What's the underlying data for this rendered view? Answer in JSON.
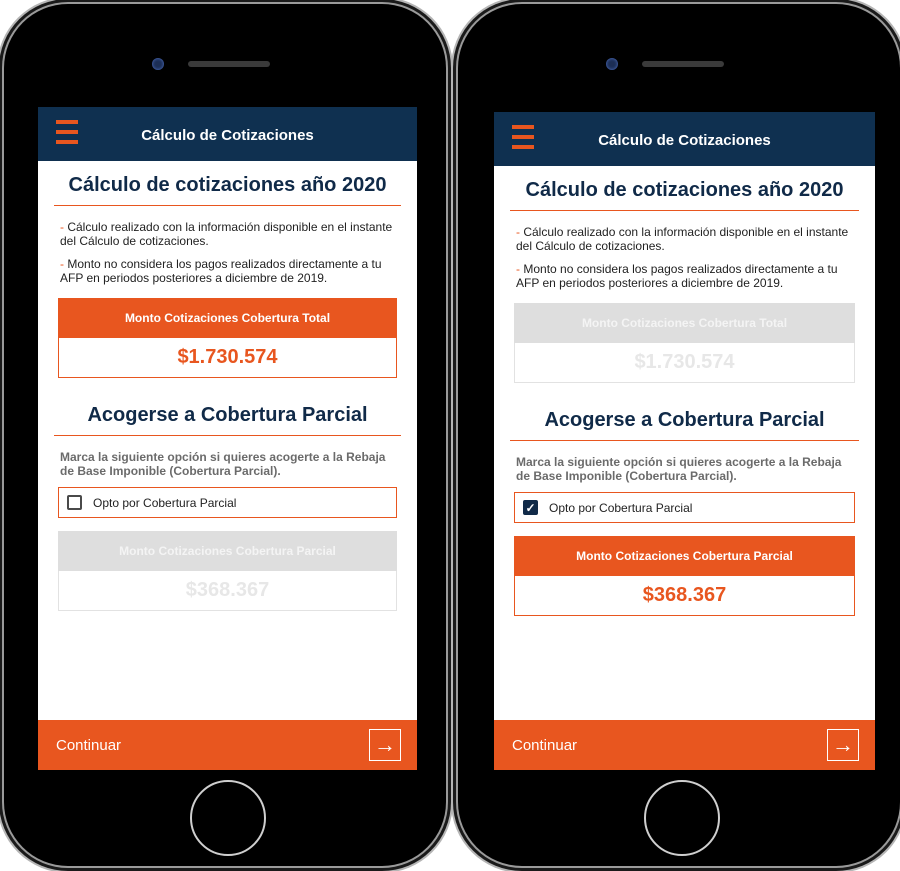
{
  "screens": [
    {
      "header_title": "Cálculo de Cotizaciones",
      "heading": "Cálculo de cotizaciones año 2020",
      "notes": [
        "Cálculo realizado con la información disponible en el instante del Cálculo de cotizaciones.",
        "Monto no considera los pagos realizados directamente a tu AFP en periodos posteriores a diciembre de 2019."
      ],
      "note_dash": "-",
      "total": {
        "label": "Monto Cotizaciones Cobertura Total",
        "value": "$1.730.574",
        "enabled": true
      },
      "partial_heading": "Acogerse a Cobertura Parcial",
      "partial_desc": "Marca la siguiente opción si quieres acogerte a la Rebaja de Base Imponible (Cobertura Parcial).",
      "option": {
        "label": "Opto por Cobertura Parcial",
        "checked": false
      },
      "partial": {
        "label": "Monto Cotizaciones Cobertura Parcial",
        "value": "$368.367",
        "enabled": false
      },
      "continue_label": "Continuar",
      "arrow_glyph": "→"
    },
    {
      "header_title": "Cálculo de Cotizaciones",
      "heading": "Cálculo de cotizaciones año 2020",
      "notes": [
        "Cálculo realizado con la información disponible en el instante del Cálculo de cotizaciones.",
        "Monto no considera los pagos realizados directamente a tu AFP en periodos posteriores a diciembre de 2019."
      ],
      "note_dash": "-",
      "total": {
        "label": "Monto Cotizaciones Cobertura Total",
        "value": "$1.730.574",
        "enabled": false
      },
      "partial_heading": "Acogerse a Cobertura Parcial",
      "partial_desc": "Marca la siguiente opción si quieres acogerte a la Rebaja de Base Imponible (Cobertura Parcial).",
      "option": {
        "label": "Opto por Cobertura Parcial",
        "checked": true
      },
      "partial": {
        "label": "Monto Cotizaciones Cobertura Parcial",
        "value": "$368.367",
        "enabled": true
      },
      "continue_label": "Continuar",
      "arrow_glyph": "→"
    }
  ],
  "colors": {
    "brand_orange": "#e8561f",
    "navy": "#0f3050",
    "disabled_gray": "#dedede"
  },
  "icons": {
    "menu": "hamburger-menu-icon",
    "next": "arrow-right-icon",
    "check": "checkmark-icon"
  }
}
